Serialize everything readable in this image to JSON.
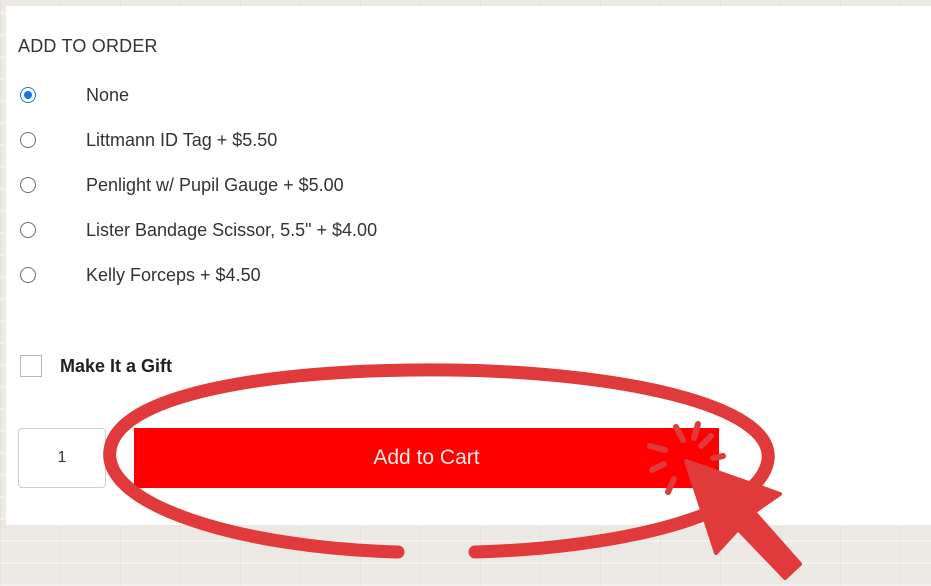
{
  "order": {
    "heading": "ADD TO ORDER",
    "options": [
      {
        "label": "None",
        "selected": true
      },
      {
        "label": "Littmann ID Tag + $5.50",
        "selected": false
      },
      {
        "label": "Penlight w/ Pupil Gauge + $5.00",
        "selected": false
      },
      {
        "label": "Lister Bandage Scissor, 5.5\" + $4.00",
        "selected": false
      },
      {
        "label": "Kelly Forceps + $4.50",
        "selected": false
      }
    ]
  },
  "gift": {
    "label": "Make It a Gift",
    "checked": false
  },
  "cart": {
    "quantity": "1",
    "button_label": "Add to Cart"
  },
  "colors": {
    "accent": "#ff0000",
    "annotation": "#e03a3a",
    "radio_selected": "#1a73e8"
  },
  "icons": {
    "overlay": "hand-drawn-ellipse",
    "pointer": "cursor-arrow-icon",
    "click": "click-burst-icon"
  }
}
